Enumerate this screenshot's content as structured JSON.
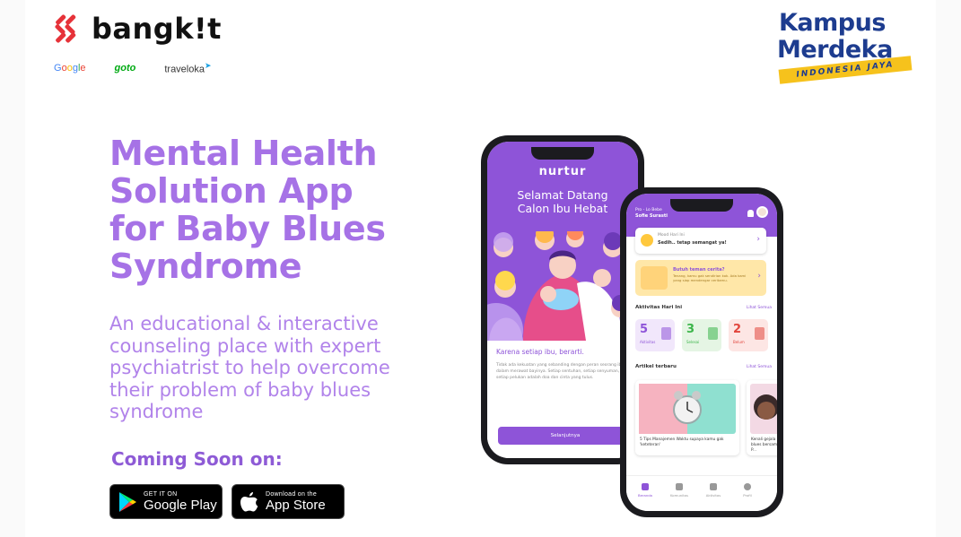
{
  "branding": {
    "bangkit_logo": "bangk!t",
    "partners": [
      "Google",
      "goto",
      "traveloka"
    ],
    "kampus_merdeka": {
      "line1": "Kampus",
      "line2": "Merdeka",
      "ribbon": "INDONESIA JAYA"
    }
  },
  "hero": {
    "headline": [
      "Mental Health",
      "Solution App",
      "for Baby Blues",
      "Syndrome"
    ],
    "subheadline": [
      "An educational & interactive",
      "counseling place with expert",
      "psychiatrist to help overcome",
      "their problem of baby blues",
      "syndrome"
    ],
    "coming_soon": "Coming Soon on:"
  },
  "stores": {
    "google_play": {
      "small": "GET IT ON",
      "big": "Google Play"
    },
    "app_store": {
      "small": "Download on the",
      "big": "App Store"
    }
  },
  "phone_welcome": {
    "app_logo": "nurtur",
    "title": [
      "Selamat Datang",
      "Calon Ibu Hebat"
    ],
    "subtitle": "Karena setiap ibu, berarti.",
    "paragraph": "Tidak ada kekuatan yang sebanding dengan peran seorang ibu dalam merawat bayinya. Setiap sentuhan, setiap senyuman, setiap pelukan adalah doa dan cinta yang tulus.",
    "cta": "Selanjutnya"
  },
  "phone_home": {
    "greeting_small": "Pro - Lo Bebe",
    "greeting_name": "Sofie Surasti",
    "mood_label": "Mood Hari Ini",
    "mood_value": "Sedih.. tetap semangat ya!",
    "talk_title": "Butuh teman cerita?",
    "talk_desc": "Tenang, kamu gak sendirian kok. Ada kami yang siap mendengar ceritamu.",
    "activities_title": "Aktivitas Hari Ini",
    "see_all": "Lihat Semua",
    "stats": [
      {
        "num": "5",
        "label": "Aktivitas",
        "color": "#8e54d8",
        "bg": "#f1e7fb"
      },
      {
        "num": "3",
        "label": "Selesai",
        "color": "#3bb54a",
        "bg": "#e5f5e4"
      },
      {
        "num": "2",
        "label": "Belum",
        "color": "#e2453c",
        "bg": "#fde6e4"
      }
    ],
    "articles_title": "Artikel terbaru",
    "articles": [
      {
        "title": "5 Tips Manajemen Waktu supaya kamu gak 'keteteran'"
      },
      {
        "title": "Kenali gejala baby blues bersama dr. Rifky P..."
      }
    ],
    "nav": [
      "Beranda",
      "Komunitas",
      "Aktivitas",
      "Profil"
    ]
  },
  "colors": {
    "brand_purple": "#8e54d8",
    "headline_purple": "#a672e6",
    "bangkit_red": "#e63239",
    "kampus_blue": "#1d3c8f",
    "ribbon_yellow": "#f6c21c"
  }
}
